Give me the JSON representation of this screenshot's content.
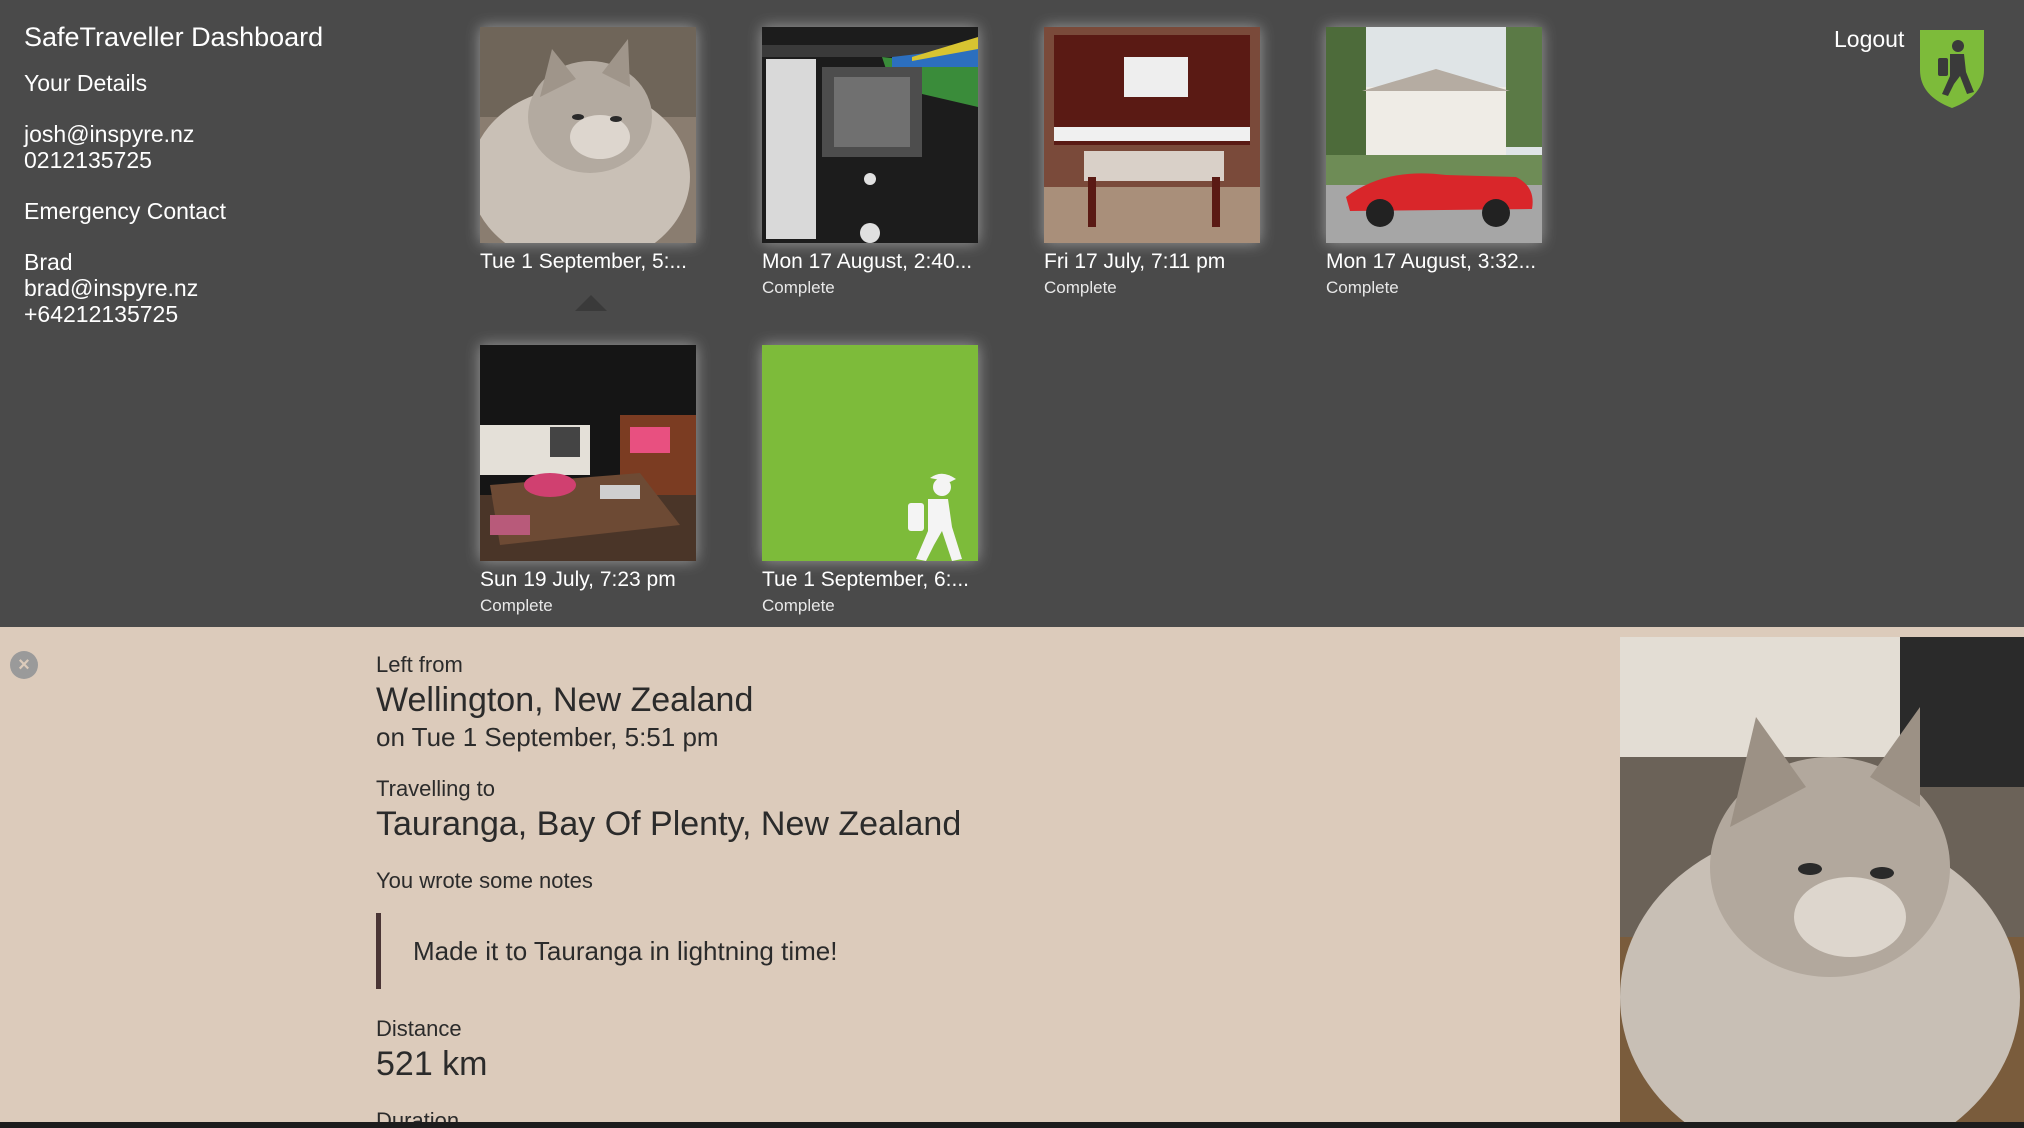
{
  "sidebar": {
    "title": "SafeTraveller Dashboard",
    "your_details_label": "Your Details",
    "email": "josh@inspyre.nz",
    "phone": "0212135725",
    "emergency_label": "Emergency Contact",
    "contact_name": "Brad",
    "contact_email": "brad@inspyre.nz",
    "contact_phone": "+64212135725"
  },
  "header": {
    "logout_label": "Logout",
    "logo_icon": "walking-traveller-shield-icon"
  },
  "trips": [
    {
      "date": "Tue 1 September, 5:...",
      "status": "",
      "image": "cat"
    },
    {
      "date": "Mon 17 August, 2:40...",
      "status": "Complete",
      "image": "phone-screen"
    },
    {
      "date": "Fri 17 July, 7:11 pm",
      "status": "Complete",
      "image": "piano"
    },
    {
      "date": "Mon 17 August, 3:32...",
      "status": "Complete",
      "image": "red-car-house"
    },
    {
      "date": "Sun 19 July, 7:23 pm",
      "status": "Complete",
      "image": "living-room"
    },
    {
      "date": "Tue 1 September, 6:...",
      "status": "Complete",
      "image": "green-traveller-placeholder"
    }
  ],
  "detail": {
    "left_from_label": "Left from",
    "left_from": "Wellington, New Zealand",
    "left_on": "on Tue 1 September, 5:51 pm",
    "travelling_to_label": "Travelling to",
    "travelling_to": "Tauranga, Bay Of Plenty, New Zealand",
    "notes_label": "You wrote some notes",
    "notes": "Made it to Tauranga in lightning time!",
    "distance_label": "Distance",
    "distance": "521 km",
    "duration_label": "Duration",
    "close_icon": "close-icon"
  },
  "colors": {
    "background": "#4a4a4a",
    "detail_panel": "#dccbbb",
    "brand_green": "#7dbb3a"
  }
}
